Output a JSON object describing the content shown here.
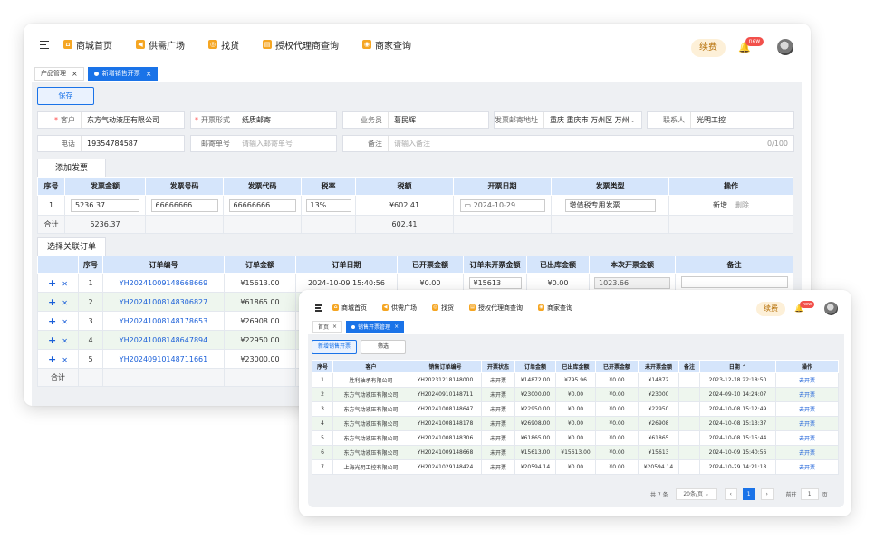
{
  "nav": {
    "items": [
      {
        "label": "商城首页",
        "icon": "home-icon"
      },
      {
        "label": "供需广场",
        "icon": "megaphone-icon"
      },
      {
        "label": "找货",
        "icon": "search-goods-icon"
      },
      {
        "label": "授权代理商查询",
        "icon": "document-icon"
      },
      {
        "label": "商家查询",
        "icon": "shop-icon"
      }
    ],
    "renew": "续费",
    "badge": "new"
  },
  "back": {
    "tabs": [
      {
        "label": "产品管理"
      },
      {
        "label": "新增销售开票"
      }
    ],
    "save": "保存",
    "form": {
      "customer": {
        "label": "客户",
        "value": "东方气动液压有限公司"
      },
      "invoice_form": {
        "label": "开票形式",
        "value": "纸质邮寄"
      },
      "salesman": {
        "label": "业务员",
        "value": "葛民辉"
      },
      "address": {
        "label": "发票邮寄地址",
        "value": "重庆 重庆市 万州区 万州"
      },
      "contact": {
        "label": "联系人",
        "value": "光明工控"
      },
      "phone": {
        "label": "电话",
        "value": "19354784587"
      },
      "post_no": {
        "label": "邮寄单号",
        "placeholder": "请输入邮寄单号"
      },
      "remark": {
        "label": "备注",
        "placeholder": "请输入备注",
        "count": "0/100"
      }
    },
    "add_invoice": "添加发票",
    "invoice_table": {
      "headers": [
        "序号",
        "发票金额",
        "发票号码",
        "发票代码",
        "税率",
        "税额",
        "开票日期",
        "发票类型",
        "操作"
      ],
      "row": {
        "index": "1",
        "amount": "5236.37",
        "number": "66666666",
        "code": "66666666",
        "rate": "13%",
        "tax": "¥602.41",
        "date": "2024-10-29",
        "type": "增值税专用发票",
        "op_add": "新增",
        "op_del": "删除"
      },
      "total": {
        "label": "合计",
        "amount": "5236.37",
        "tax": "602.41"
      }
    },
    "link_orders": "选择关联订单",
    "order_table": {
      "headers": [
        "序号",
        "订单编号",
        "订单金额",
        "订单日期",
        "已开票金额",
        "订单未开票金额",
        "已出库金额",
        "本次开票金额",
        "备注"
      ],
      "rows": [
        {
          "index": "1",
          "no": "YH20241009148668669",
          "amount": "¥15613.00",
          "date": "2024-10-09 15:40:56",
          "invoiced": "¥0.00",
          "uninvoiced": "¥15613",
          "shipped": "¥0.00",
          "this": "1023.66"
        },
        {
          "index": "2",
          "no": "YH20241008148306827",
          "amount": "¥61865.00",
          "date": "",
          "invoiced": "",
          "uninvoiced": "",
          "shipped": "",
          "this": ""
        },
        {
          "index": "3",
          "no": "YH20241008148178653",
          "amount": "¥26908.00",
          "date": "",
          "invoiced": "",
          "uninvoiced": "",
          "shipped": "",
          "this": ""
        },
        {
          "index": "4",
          "no": "YH20241008148647894",
          "amount": "¥22950.00",
          "date": "",
          "invoiced": "",
          "uninvoiced": "",
          "shipped": "",
          "this": ""
        },
        {
          "index": "5",
          "no": "YH20240910148711661",
          "amount": "¥23000.00",
          "date": "",
          "invoiced": "",
          "uninvoiced": "",
          "shipped": "",
          "this": ""
        }
      ],
      "total": "合计"
    }
  },
  "front": {
    "tabs": [
      {
        "label": "首页"
      },
      {
        "label": "销售开票管理"
      }
    ],
    "new_btn": "新增销售开票",
    "filter_btn": "筛选",
    "headers": [
      "序号",
      "客户",
      "销售订单编号",
      "开票状态",
      "订单金额",
      "已出库金额",
      "已开票金额",
      "未开票金额",
      "备注",
      "日期",
      "操作"
    ],
    "rows": [
      {
        "index": "1",
        "customer": "胜利轴承有限公司",
        "no": "YH20231218148000",
        "status": "未开票",
        "amount": "¥14872.00",
        "shipped": "¥795.96",
        "invoiced": "¥0.00",
        "uninvoiced": "¥14872",
        "remark": "",
        "date": "2023-12-18 22:18:50",
        "op": "去开票"
      },
      {
        "index": "2",
        "customer": "东方气动液压有限公司",
        "no": "YH20240910148711",
        "status": "未开票",
        "amount": "¥23000.00",
        "shipped": "¥0.00",
        "invoiced": "¥0.00",
        "uninvoiced": "¥23000",
        "remark": "",
        "date": "2024-09-10 14:24:07",
        "op": "去开票"
      },
      {
        "index": "3",
        "customer": "东方气动液压有限公司",
        "no": "YH20241008148647",
        "status": "未开票",
        "amount": "¥22950.00",
        "shipped": "¥0.00",
        "invoiced": "¥0.00",
        "uninvoiced": "¥22950",
        "remark": "",
        "date": "2024-10-08 15:12:49",
        "op": "去开票"
      },
      {
        "index": "4",
        "customer": "东方气动液压有限公司",
        "no": "YH20241008148178",
        "status": "未开票",
        "amount": "¥26908.00",
        "shipped": "¥0.00",
        "invoiced": "¥0.00",
        "uninvoiced": "¥26908",
        "remark": "",
        "date": "2024-10-08 15:13:37",
        "op": "去开票"
      },
      {
        "index": "5",
        "customer": "东方气动液压有限公司",
        "no": "YH20241008148306",
        "status": "未开票",
        "amount": "¥61865.00",
        "shipped": "¥0.00",
        "invoiced": "¥0.00",
        "uninvoiced": "¥61865",
        "remark": "",
        "date": "2024-10-08 15:15:44",
        "op": "去开票"
      },
      {
        "index": "6",
        "customer": "东方气动液压有限公司",
        "no": "YH20241009148668",
        "status": "未开票",
        "amount": "¥15613.00",
        "shipped": "¥15613.00",
        "invoiced": "¥0.00",
        "uninvoiced": "¥15613",
        "remark": "",
        "date": "2024-10-09 15:40:56",
        "op": "去开票"
      },
      {
        "index": "7",
        "customer": "上海光明工控有限公司",
        "no": "YH20241029148424",
        "status": "未开票",
        "amount": "¥20594.14",
        "shipped": "¥0.00",
        "invoiced": "¥0.00",
        "uninvoiced": "¥20594.14",
        "remark": "",
        "date": "2024-10-29 14:21:18",
        "op": "去开票"
      }
    ],
    "pager": {
      "total": "共 7 条",
      "size": "20条/页",
      "page": "1",
      "goto": "前往",
      "goto_val": "1",
      "unit": "页"
    }
  }
}
